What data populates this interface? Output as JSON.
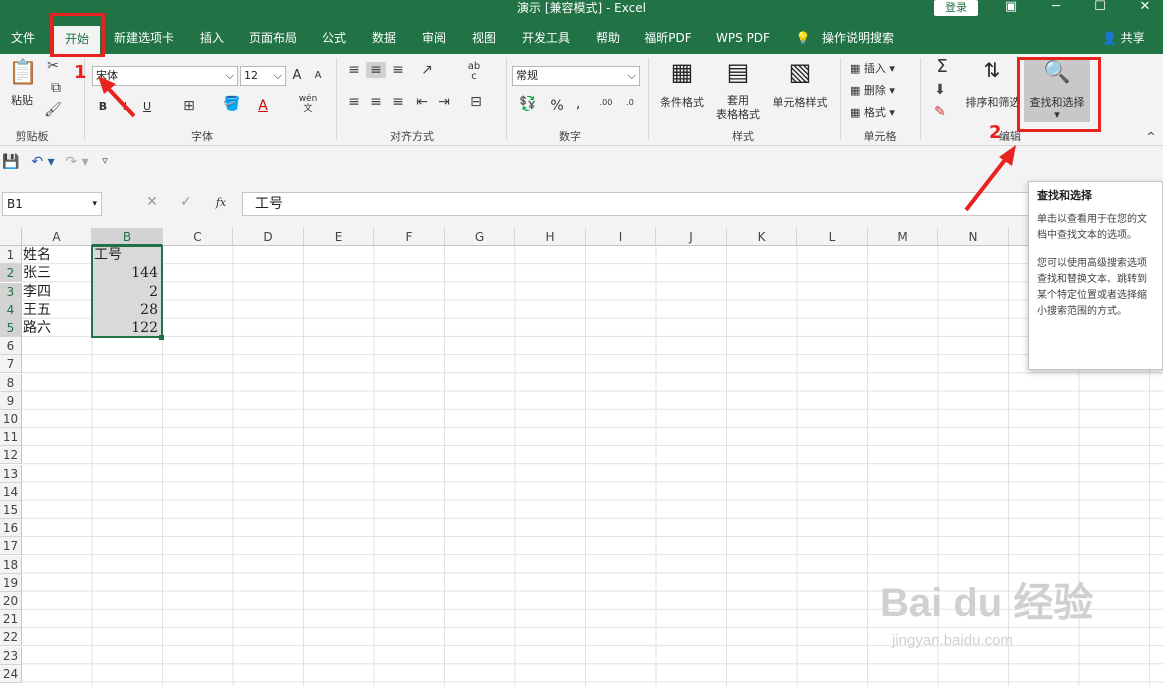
{
  "title_bar": {
    "title": "演示  [兼容模式]  -  Excel",
    "login": "登录",
    "restore_icon": "restore-window-icon",
    "minimize": "─",
    "maximize": "☐",
    "close": "✕"
  },
  "tabs": [
    {
      "label": "文件"
    },
    {
      "label": "开始"
    },
    {
      "label": "新建选项卡"
    },
    {
      "label": "插入"
    },
    {
      "label": "页面布局"
    },
    {
      "label": "公式"
    },
    {
      "label": "数据"
    },
    {
      "label": "审阅"
    },
    {
      "label": "视图"
    },
    {
      "label": "开发工具"
    },
    {
      "label": "帮助"
    },
    {
      "label": "福昕PDF"
    },
    {
      "label": "WPS PDF"
    },
    {
      "label": "操作说明搜索"
    }
  ],
  "share": "共享",
  "ribbon": {
    "clipboard": {
      "paste": "粘贴",
      "group": "剪贴板"
    },
    "font": {
      "name": "宋体",
      "size": "12",
      "bold": "B",
      "italic": "I",
      "underline": "U",
      "grow": "A",
      "shrink": "A",
      "group": "字体",
      "wen": "wén",
      "wen2": "文"
    },
    "align": {
      "group": "对齐方式",
      "wrap": "ab",
      "wrap2": "c"
    },
    "number": {
      "format": "常规",
      "percent": "%",
      "comma": "‚",
      "group": "数字",
      "inc": ".00",
      "dec": ".0"
    },
    "styles": {
      "conditional": "条件格式",
      "table1": "套用",
      "table2": "表格格式",
      "cell_styles": "单元格样式",
      "group": "样式"
    },
    "cells": {
      "insert": "插入",
      "delete": "删除",
      "format": "格式",
      "group": "单元格"
    },
    "editing": {
      "sum": "Σ",
      "sort": "排序和筛选",
      "find": "查找和选择",
      "group": "编辑"
    }
  },
  "formula_bar": {
    "namebox": "B1",
    "fx": "fx",
    "value": "工号"
  },
  "grid": {
    "columns": [
      "A",
      "B",
      "C",
      "D",
      "E",
      "F",
      "G",
      "H",
      "I",
      "J",
      "K",
      "L",
      "M",
      "N"
    ],
    "rows": [
      "1",
      "2",
      "3",
      "4",
      "5",
      "6",
      "7",
      "8",
      "9",
      "10",
      "11",
      "12",
      "13",
      "14",
      "15",
      "16",
      "17",
      "18",
      "19",
      "20",
      "21",
      "22",
      "23",
      "24"
    ],
    "cells": [
      {
        "a": "姓名",
        "b": "工号"
      },
      {
        "a": "张三",
        "b": "144"
      },
      {
        "a": "李四",
        "b": "2"
      },
      {
        "a": "王五",
        "b": "28"
      },
      {
        "a": "路六",
        "b": "122"
      }
    ]
  },
  "tooltip": {
    "title": "查找和选择",
    "p1": "单击以查看用于在您的文档中查找文本的选项。",
    "p2": "您可以使用高级搜索选项查找和替换文本、跳转到某个特定位置或者选择缩小搜索范围的方式。"
  },
  "annotations": {
    "step1": "1",
    "step2": "2"
  },
  "watermark": {
    "brand": "Bai du 经验",
    "url": "jingyan.baidu.com"
  },
  "colors": {
    "excel_green": "#217346",
    "annotation_red": "#e8231f"
  }
}
